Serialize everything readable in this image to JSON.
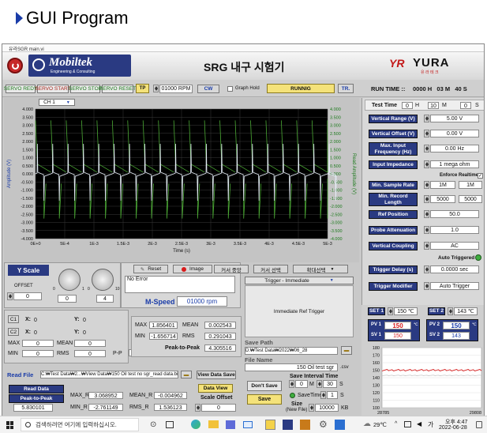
{
  "slide_title": "GUI Program",
  "window": {
    "title": "유라SGR main.vi"
  },
  "header": {
    "company": "Mobiltek",
    "company_sub": "Engineering & Consulting",
    "app_title": "SRG 내구 시험기",
    "brand": "YURA",
    "brand_sub": "유 라 테 크"
  },
  "toolbar": {
    "servo_ready": "SERVO REDY",
    "servo_start": "SERVO START",
    "servo_stop": "SERVO STOP",
    "servo_reset": "SERVO RESET",
    "tp": "TP",
    "rpm": "01000 RPM",
    "direction": "CW",
    "graph_hold": "Graph Hold",
    "running": "RUNNIG",
    "tr": "TR.",
    "run_time_label": "RUN TIME ::",
    "run_time_value": "0000 H   03 M   40 S"
  },
  "chart": {
    "channel": "CH 1",
    "ylabel_left": "Amplitude (V)",
    "ylabel_right": "Read Amplitude (V)",
    "xlabel": "Time (s)",
    "yticks": [
      "4.000",
      "3.500",
      "3.000",
      "2.500",
      "2.000",
      "1.500",
      "1.000",
      "0.500",
      "0.000",
      "-0.500",
      "-1.000",
      "-1.500",
      "-2.000",
      "-2.500",
      "-3.000",
      "-3.500",
      "-4.000"
    ],
    "yticks_right": [
      "4.000",
      "3.500",
      "3.000",
      "2.500",
      "2.000",
      "1.500",
      "1.000",
      "0.500",
      "0.000",
      "-0.500",
      "-1.000",
      "-1.500",
      "-2.000",
      "-2.500",
      "-3.000",
      "-3.500",
      "-4.000"
    ],
    "xticks": [
      "0E+0",
      "5E-4",
      "1E-3",
      "1.5E-3",
      "2E-3",
      "2.5E-3",
      "3E-3",
      "3.5E-3",
      "4E-3",
      "4.5E-3",
      "5E-3"
    ]
  },
  "chart_data": {
    "type": "line",
    "xlabel": "Time (s)",
    "ylabel": "Amplitude (V)",
    "xlim": [
      0,
      0.005
    ],
    "ylim": [
      -4,
      4
    ],
    "grid": true,
    "period": 0.000263,
    "series": [
      {
        "color": "#e6eef8",
        "amplitude_peak": 1.856,
        "amplitude_min": -1.657
      },
      {
        "color": "#4caa35",
        "amplitude_peak": 3.3,
        "amplitude_min": -2.76
      }
    ]
  },
  "yscale": {
    "label": "Y Scale",
    "offset_label": "OFFSET",
    "offset_value": "0",
    "knob1_value": "0",
    "knob2_value": "4",
    "knob1_min": "0",
    "knob1_max": "1",
    "knob2_min": "0",
    "knob2_max": "10"
  },
  "controls": {
    "reset": "Reset",
    "image": "Image",
    "cursor_center": "커서 중앙",
    "cursor_select": "커서 선택",
    "zoom_select": "확대선택",
    "error": "No Error",
    "mspeed_label": "M-Speed",
    "mspeed_value": "01000 rpm"
  },
  "cursors": {
    "c1": "C1",
    "c2": "C2",
    "x_label": "X:",
    "y_label": "Y:",
    "c1_x": "0",
    "c1_y": "0",
    "c2_x": "0",
    "c2_y": "0",
    "max_label": "MAX",
    "min_label": "MIN",
    "mean_label": "MEAN",
    "rms_label": "RMS",
    "pp_label": "P-P",
    "max": "0",
    "min": "0",
    "mean": "0",
    "rms": "0",
    "pp": "0"
  },
  "stats": {
    "max_label": "MAX",
    "max": "1.856401",
    "mean_label": "MEAN",
    "mean": "0.002543",
    "min_label": "MIN",
    "min": "-1.656714",
    "rms_label": "RMS",
    "rms": "0.291043",
    "ptp_label": "Peak-to-Peak",
    "ptp": "4.305516"
  },
  "file": {
    "read_file_label": "Read File",
    "read_file_path": "C:₩Test Data₩2...₩View Data₩150 Oil test no sgr_read data.bin",
    "read_data": "Read Data",
    "ptp_label": "Peak-to-Peak",
    "ptp_value": "5.830101",
    "maxr_label": "MAX_R",
    "maxr": "3.068952",
    "minr_label": "MIN_R",
    "minr": "-2.761149",
    "meanr_label": "MEAN_R",
    "meanr": "-0.004962",
    "rmsr_label": "RMS_R",
    "rmsr": "1.536123",
    "view_data_save": "View Data Save",
    "data_view": "Data View",
    "scale_offset": "Scale Offset",
    "scale_offset_value": "0"
  },
  "trigger": {
    "select": "Trigger - Immediate",
    "message": "Immediate Ref Trigger"
  },
  "save": {
    "save_path_label": "Save Path",
    "save_path": "D:₩Test Data₩2022₩06_28",
    "file_name_label": "File Name",
    "file_name": "150 Oil test  sgr",
    "ext": ".csv",
    "dont_save": "Don't Save",
    "save": "Save",
    "interval_label": "Save Interval Time",
    "interval_m": "0",
    "interval_m_unit": "M",
    "interval_s": "30",
    "interval_s_unit": "S",
    "savetime_label": "SaveTime",
    "savetime_value": "1",
    "savetime_unit": "S",
    "size_label": "Size",
    "newfile_label": "(New File)",
    "size_value": "10000",
    "size_unit": "KB"
  },
  "settings": {
    "test_time_label": "Test Time",
    "tt_h": "0",
    "tt_m": "10",
    "tt_s": "0",
    "h": "H",
    "m": "M",
    "s": "S",
    "vrange_label": "Vertical Range (V)",
    "vrange": "5.00 V",
    "voffset_label": "Vertical Offset (V)",
    "voffset": "0.00 V",
    "maxfreq_label": "Max. Input Frequency (Hz)",
    "maxfreq": "0.00 Hz",
    "impedance_label": "Input Impedance",
    "impedance": "1 mega ohm",
    "enforce_label": "Enforce Realtime",
    "sample_label": "Min. Sample Rate",
    "sample1": "1M",
    "sample2": "1M",
    "record_label": "Min. Record Length",
    "record1": "5000",
    "record2": "5000",
    "refpos_label": "Ref Position",
    "refpos": "50.0",
    "probe_label": "Probe Attenuation",
    "probe": "1.0",
    "coupling_label": "Vertical Coupling",
    "coupling": "AC",
    "auto_trig_label": "Auto Triggered",
    "trig_delay_label": "Trigger Delay (s)",
    "trig_delay": "0.0000 sec",
    "trig_mod_label": "Trigger Modifier",
    "trig_mod": "Auto Trigger"
  },
  "pv": {
    "set1_label": "SET 1",
    "set1": "150 ℃",
    "set2_label": "SET 2",
    "set2": "143 ℃",
    "pv1_label": "PV 1",
    "pv1": "150",
    "sv1_label": "SV 1",
    "sv1": "150",
    "pv2_label": "PV 2",
    "pv2": "150",
    "sv2_label": "SV 2",
    "sv2": "143",
    "unit": "℃"
  },
  "trend": {
    "yticks": [
      "180",
      "170",
      "160",
      "150",
      "140",
      "130",
      "120",
      "110",
      "100"
    ],
    "x_start": "28785",
    "x_end": "29808",
    "colors": [
      "#d81b1b",
      "#c8c8c8"
    ]
  },
  "taskbar": {
    "search_placeholder": "검색하려면 여기에 입력하십시오.",
    "weather": "29℃",
    "time": "오후 4:47",
    "date": "2022-06-28"
  }
}
